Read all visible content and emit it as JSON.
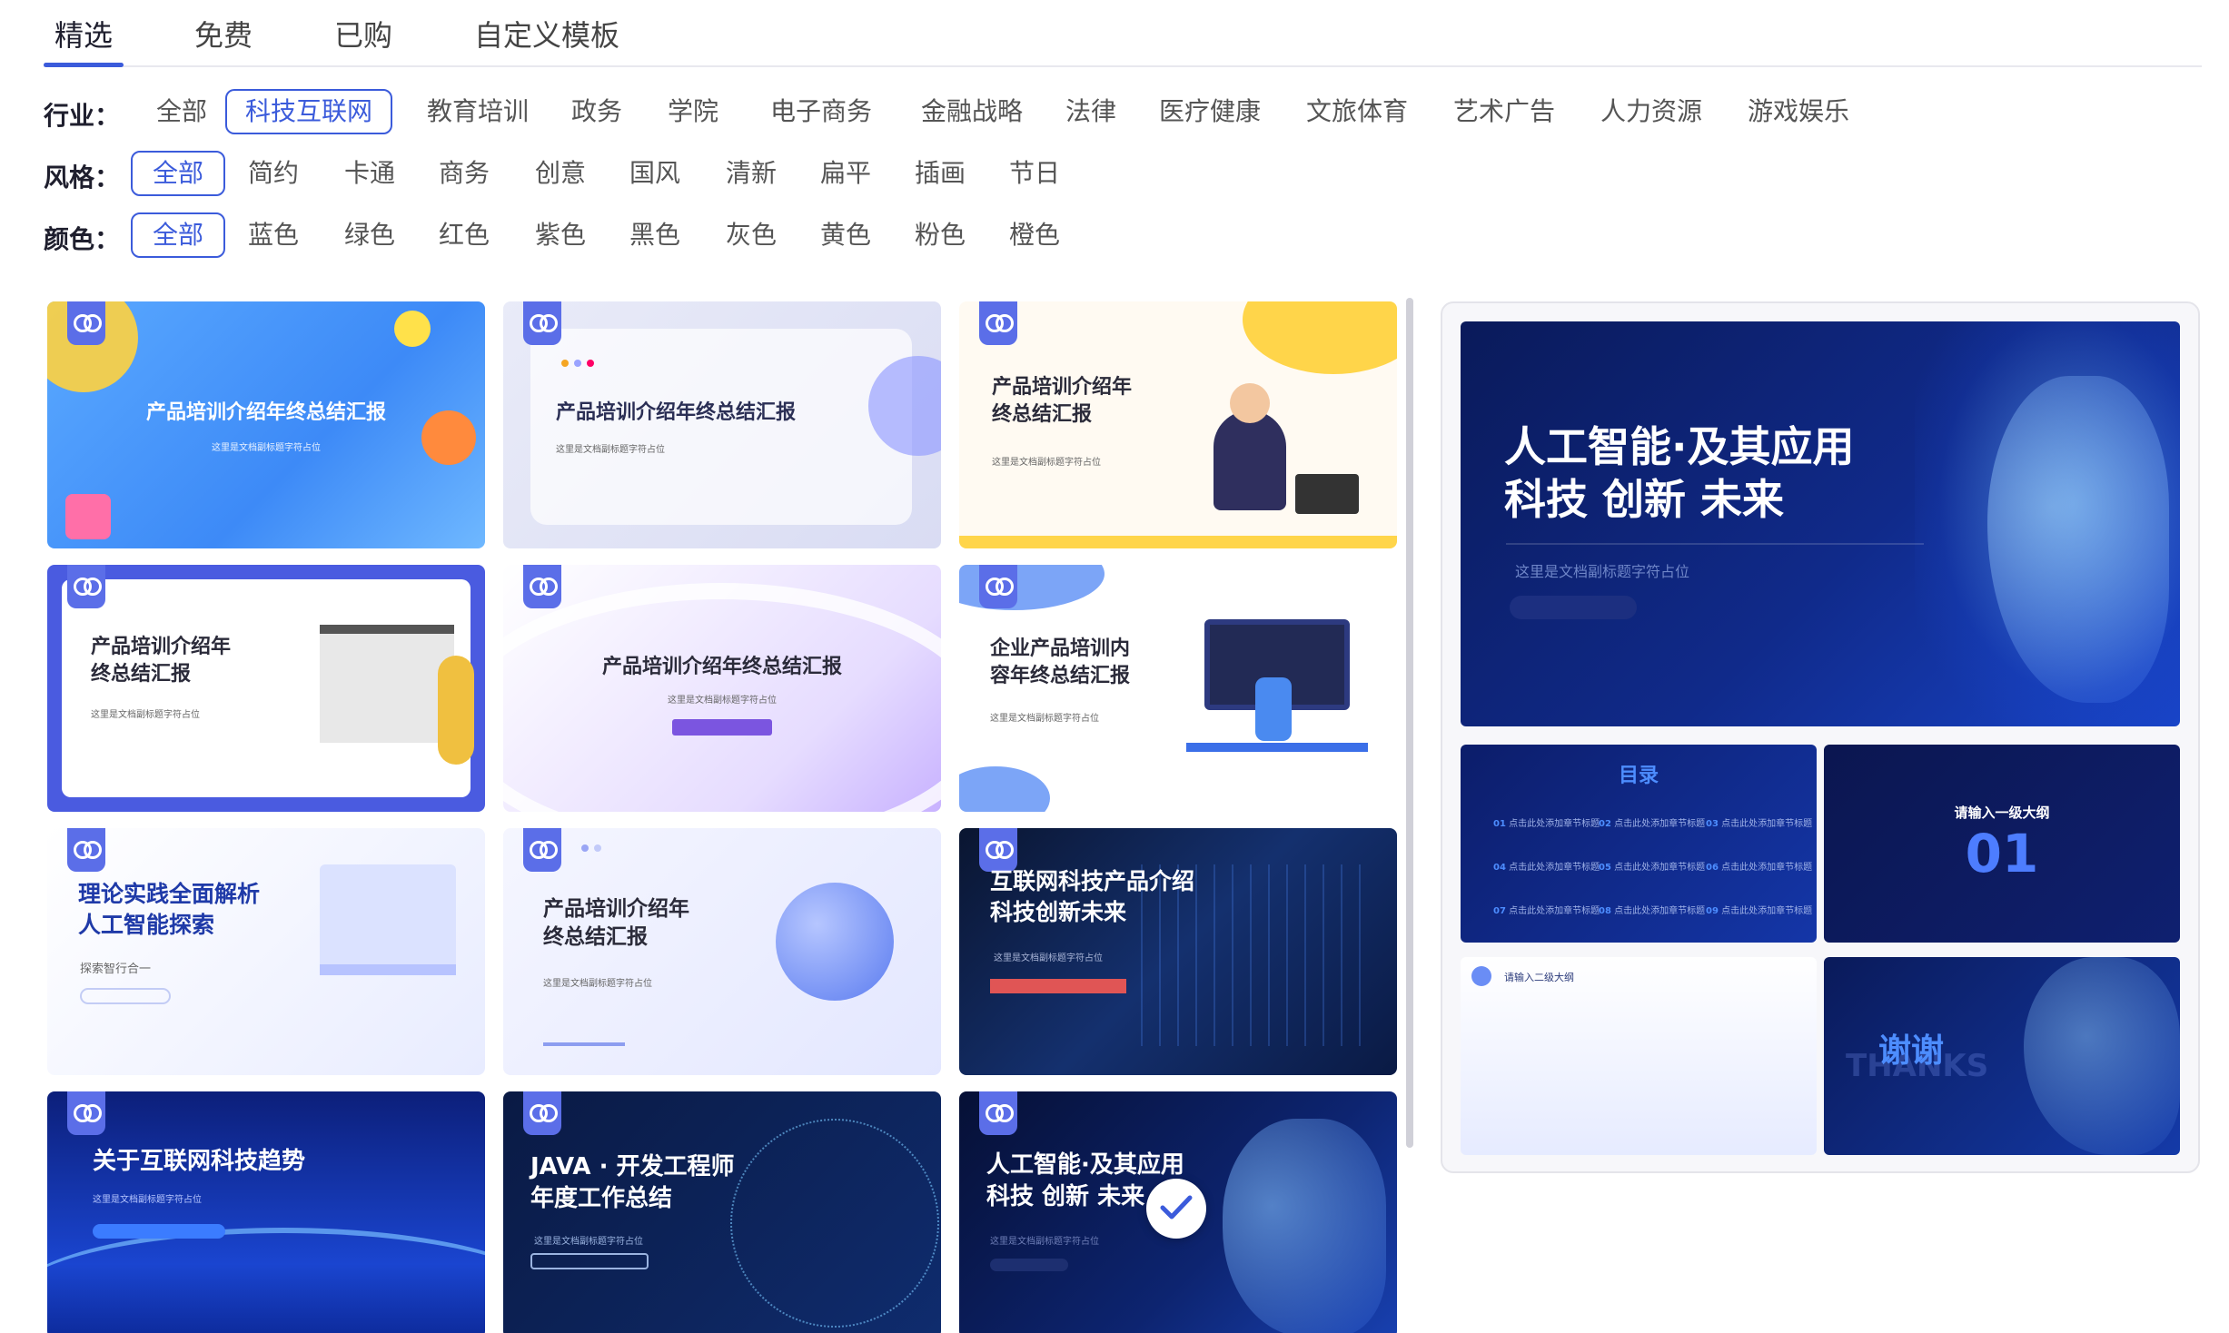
{
  "tabs": [
    {
      "label": "精选",
      "active": true
    },
    {
      "label": "免费",
      "active": false
    },
    {
      "label": "已购",
      "active": false
    },
    {
      "label": "自定义模板",
      "active": false
    }
  ],
  "filters": {
    "industry": {
      "label": "行业：",
      "selected": "科技互联网",
      "options": [
        "全部",
        "科技互联网",
        "教育培训",
        "政务",
        "学院",
        "电子商务",
        "金融战略",
        "法律",
        "医疗健康",
        "文旅体育",
        "艺术广告",
        "人力资源",
        "游戏娱乐"
      ]
    },
    "style": {
      "label": "风格：",
      "selected": "全部",
      "options": [
        "全部",
        "简约",
        "卡通",
        "商务",
        "创意",
        "国风",
        "清新",
        "扁平",
        "插画",
        "节日"
      ]
    },
    "color": {
      "label": "颜色：",
      "selected": "全部",
      "options": [
        "全部",
        "蓝色",
        "绿色",
        "红色",
        "紫色",
        "黑色",
        "灰色",
        "黄色",
        "粉色",
        "橙色"
      ]
    }
  },
  "templates": [
    {
      "title": "产品培训介绍年终总结汇报",
      "sub": "这里是文档副标题字符占位"
    },
    {
      "title": "产品培训介绍年终总结汇报",
      "sub": "这里是文档副标题字符占位"
    },
    {
      "title": "产品培训介绍年\n终总结汇报",
      "sub": "这里是文档副标题字符占位"
    },
    {
      "title": "产品培训介绍年\n终总结汇报",
      "sub": "这里是文档副标题字符占位"
    },
    {
      "title": "产品培训介绍年终总结汇报",
      "sub": "这里是文档副标题字符占位"
    },
    {
      "title": "企业产品培训内\n容年终总结汇报",
      "sub": "这里是文档副标题字符占位"
    },
    {
      "title": "理论实践全面解析\n人工智能探索",
      "sub": "探索智行合一"
    },
    {
      "title": "产品培训介绍年\n终总结汇报",
      "sub": "这里是文档副标题字符占位"
    },
    {
      "title": "互联网科技产品介绍\n科技创新未来",
      "sub": "这里是文档副标题字符占位"
    },
    {
      "title": "关于互联网科技趋势",
      "sub": "这里是文档副标题字符占位"
    },
    {
      "title": "JAVA · 开发工程师\n年度工作总结",
      "sub": "这里是文档副标题字符占位"
    },
    {
      "title": "人工智能·及其应用\n科技 创新 未来",
      "sub": "这里是文档副标题字符占位",
      "selected": true
    }
  ],
  "preview": {
    "cover_title": "人工智能·及其应用\n科技 创新 未来",
    "cover_sub": "这里是文档副标题字符占位",
    "toc_title": "目录",
    "toc_items": [
      {
        "num": "01",
        "text": "点击此处添加章节标题"
      },
      {
        "num": "02",
        "text": "点击此处添加章节标题"
      },
      {
        "num": "03",
        "text": "点击此处添加章节标题"
      },
      {
        "num": "04",
        "text": "点击此处添加章节标题"
      },
      {
        "num": "05",
        "text": "点击此处添加章节标题"
      },
      {
        "num": "06",
        "text": "点击此处添加章节标题"
      },
      {
        "num": "07",
        "text": "点击此处添加章节标题"
      },
      {
        "num": "08",
        "text": "点击此处添加章节标题"
      },
      {
        "num": "09",
        "text": "点击此处添加章节标题"
      }
    ],
    "section_label": "请输入一级大纲",
    "section_num": "01",
    "subsection_label": "请输入二级大纲",
    "thanks": "谢谢",
    "thanks_en": "THANKS"
  },
  "colors": {
    "accent": "#3b5bdb",
    "selected_border": "#3b5bdb",
    "preview_bg": "#0c1a5c"
  }
}
